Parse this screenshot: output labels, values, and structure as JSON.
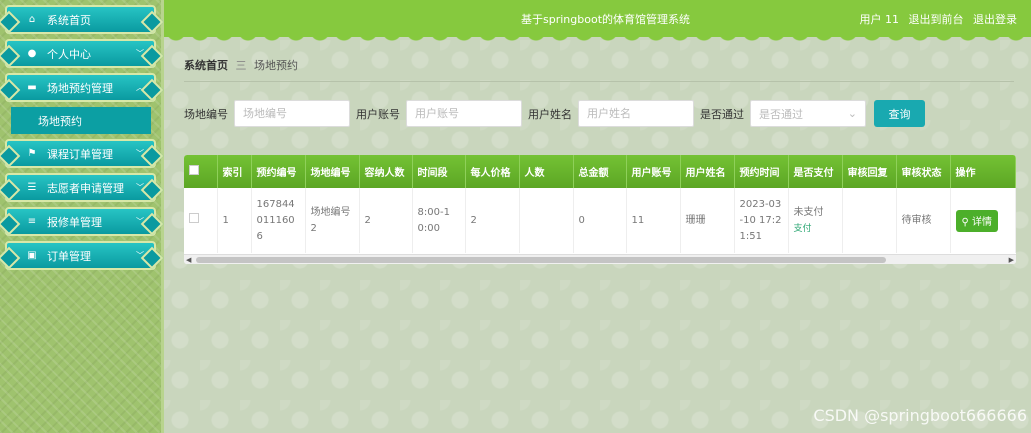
{
  "sidebar": {
    "items": [
      {
        "label": "系统首页",
        "icon": "home-icon",
        "chev": ""
      },
      {
        "label": "个人中心",
        "icon": "user-icon",
        "chev": "﹀"
      },
      {
        "label": "场地预约管理",
        "icon": "briefcase-icon",
        "chev": "︿"
      },
      {
        "label": "课程订单管理",
        "icon": "flag-icon",
        "chev": "﹀"
      },
      {
        "label": "志愿者申请管理",
        "icon": "list-icon",
        "chev": "﹀"
      },
      {
        "label": "报修单管理",
        "icon": "sliders-icon",
        "chev": "﹀"
      },
      {
        "label": "订单管理",
        "icon": "clipboard-icon",
        "chev": "﹀"
      }
    ],
    "sub_active": "场地预约"
  },
  "header": {
    "title": "基于springboot的体育馆管理系统",
    "user": "用户 11",
    "back_to_front": "退出到前台",
    "logout": "退出登录"
  },
  "breadcrumb": {
    "home": "系统首页",
    "sep": "三",
    "current": "场地预约"
  },
  "filters": {
    "venue_no_label": "场地编号",
    "venue_no_placeholder": "场地编号",
    "account_label": "用户账号",
    "account_placeholder": "用户账号",
    "name_label": "用户姓名",
    "name_placeholder": "用户姓名",
    "passed_label": "是否通过",
    "passed_placeholder": "是否通过",
    "query_button": "查询"
  },
  "table": {
    "headers": [
      "索引",
      "预约编号",
      "场地编号",
      "容纳人数",
      "时间段",
      "每人价格",
      "人数",
      "总金额",
      "用户账号",
      "用户姓名",
      "预约时间",
      "是否支付",
      "审核回复",
      "审核状态",
      "操作"
    ],
    "rows": [
      {
        "index": "1",
        "booking_no": "1678440111606",
        "venue_no": "场地编号2",
        "capacity": "2",
        "time_slot": "8:00-10:00",
        "price_per_person": "2",
        "people": "",
        "total": "0",
        "account": "11",
        "name": "珊珊",
        "booked_at": "2023-03-10 17:21:51",
        "paid": "未支付",
        "pay_link": "支付",
        "reply": "",
        "status": "待审核",
        "detail_button": "详情"
      }
    ]
  },
  "colors": {
    "header_green": "#86c93e",
    "menu_teal": "#0a9aa0",
    "table_header_green": "#74c234",
    "query_button": "#19a9b0",
    "detail_button": "#4caf2a"
  },
  "watermark": "CSDN @springboot666666"
}
